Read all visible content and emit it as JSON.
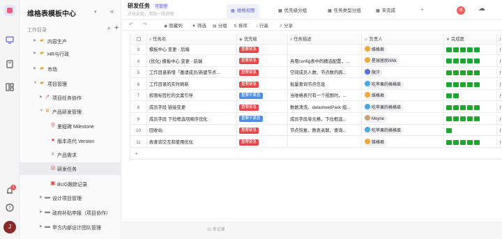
{
  "rail": {
    "icons": [
      "app-logo",
      "monitor-icon",
      "book-icon",
      "layout-icon",
      "bell-icon",
      "help-icon"
    ],
    "notification_count": "1",
    "avatar_letter": "J"
  },
  "sidebar": {
    "space_title": "维格表模板中心",
    "directory_label": "工作目录",
    "items": [
      {
        "label": "内容生产",
        "icon": "group-folder-icon"
      },
      {
        "label": "HR与行政",
        "icon": "group-folder-icon"
      },
      {
        "label": "市场",
        "icon": "group-folder-icon"
      },
      {
        "label": "项目管理",
        "icon": "group-folder-icon"
      },
      {
        "label": "项目任务协作",
        "icon": "rocket-icon"
      },
      {
        "label": "产品研发管理",
        "icon": "trophy-icon"
      },
      {
        "label": "里程碑 Milestone",
        "icon": "pin-icon"
      },
      {
        "label": "版本迭代 Version",
        "icon": "cycle-icon"
      },
      {
        "label": "产品需求",
        "icon": "magnifier-icon"
      },
      {
        "label": "研发任务",
        "icon": "target-icon"
      },
      {
        "label": "BUG跟踪记录",
        "icon": "bug-icon"
      },
      {
        "label": "设计项目管理",
        "icon": "folder-icon"
      },
      {
        "label": "政府补贴申报（项目协作）",
        "icon": "folder-icon"
      },
      {
        "label": "甲方内部设计团队管理",
        "icon": "folder-icon"
      }
    ]
  },
  "header": {
    "title": "研发任务",
    "role_tag": "可管理",
    "description": "点击此处，添加一段说明",
    "tabs": [
      "维格视图",
      "优先级分组",
      "任务类型分组",
      "未完成"
    ],
    "user_avatar": "宛"
  },
  "toolbar": {
    "items": [
      "隐藏列",
      "筛选",
      "分组",
      "排序",
      "行高",
      "分享"
    ]
  },
  "grid": {
    "columns": [
      "任务名",
      "优先级",
      "任务描述",
      "负责人",
      "完成度",
      "提"
    ],
    "rows": [
      {
        "no": "3",
        "name": "模板中心 变更 - 后端",
        "priority": "重要紧急",
        "priority_color": "#e8484a",
        "desc": "",
        "owner": "维格君",
        "owner_color": "#f2a93b",
        "progress": 5
      },
      {
        "no": "4",
        "name": "(优化) 模板中心 变更 - 前端",
        "priority": "重要紧急",
        "priority_color": "#e8484a",
        "desc": "弃用config表中的精选配置，...",
        "owner": "星球居民NNk",
        "owner_color": "#f2a93b",
        "progress": 5
      },
      {
        "no": "5",
        "name": "工作目录新增「邀请成员/新建节点...",
        "priority": "重要紧急",
        "priority_color": "#e8484a",
        "desc": "空间成员人数、节点数的跨...",
        "owner": "限汗",
        "owner_color": "#5b6ee1",
        "progress": 5
      },
      {
        "no": "6",
        "name": "工作目录的实时刷新",
        "priority": "重要紧急",
        "priority_color": "#e8484a",
        "desc": "批量查询节点信息",
        "owner": "吃苹果的格格巫",
        "owner_color": "#4aa8e0",
        "progress": 5
      },
      {
        "no": "7",
        "name": "权限标签栏的文案引导",
        "priority": "重要不紧急",
        "priority_color": "#4d8fe6",
        "desc": "当维格表只有一个视图时，...",
        "owner": "维格君",
        "owner_color": "#f2a93b",
        "progress": 2
      },
      {
        "no": "8",
        "name": "成员字段 链接变更",
        "priority": "重要紧急",
        "priority_color": "#e8484a",
        "desc": "数据清洗、datasheetPack 组...",
        "owner": "吃苹果的格格巫",
        "owner_color": "#4aa8e0",
        "progress": 5
      },
      {
        "no": "9",
        "name": "成员字段 下拉框选项顺序优化",
        "priority": "重要不紧急",
        "priority_color": "#4d8fe6",
        "desc": "成员字段单元格，下拉框选...",
        "owner": "Moyne",
        "owner_color": "#c9a07a",
        "progress": 5
      },
      {
        "no": "10",
        "name": "回收站",
        "priority": "重要紧急",
        "priority_color": "#e8484a",
        "desc": "节点恢复、数表关联、查询...",
        "owner": "吃苹果的格格巫",
        "owner_color": "#4aa8e0",
        "progress": 1
      },
      {
        "no": "11",
        "name": "表查询交互和使用优化",
        "priority": "重要紧急",
        "priority_color": "#e8484a",
        "desc": "",
        "owner": "维格君",
        "owner_color": "#f2a93b",
        "progress": 5
      }
    ],
    "add_row": "+"
  },
  "footer": {
    "record_count": "11 条记录"
  }
}
